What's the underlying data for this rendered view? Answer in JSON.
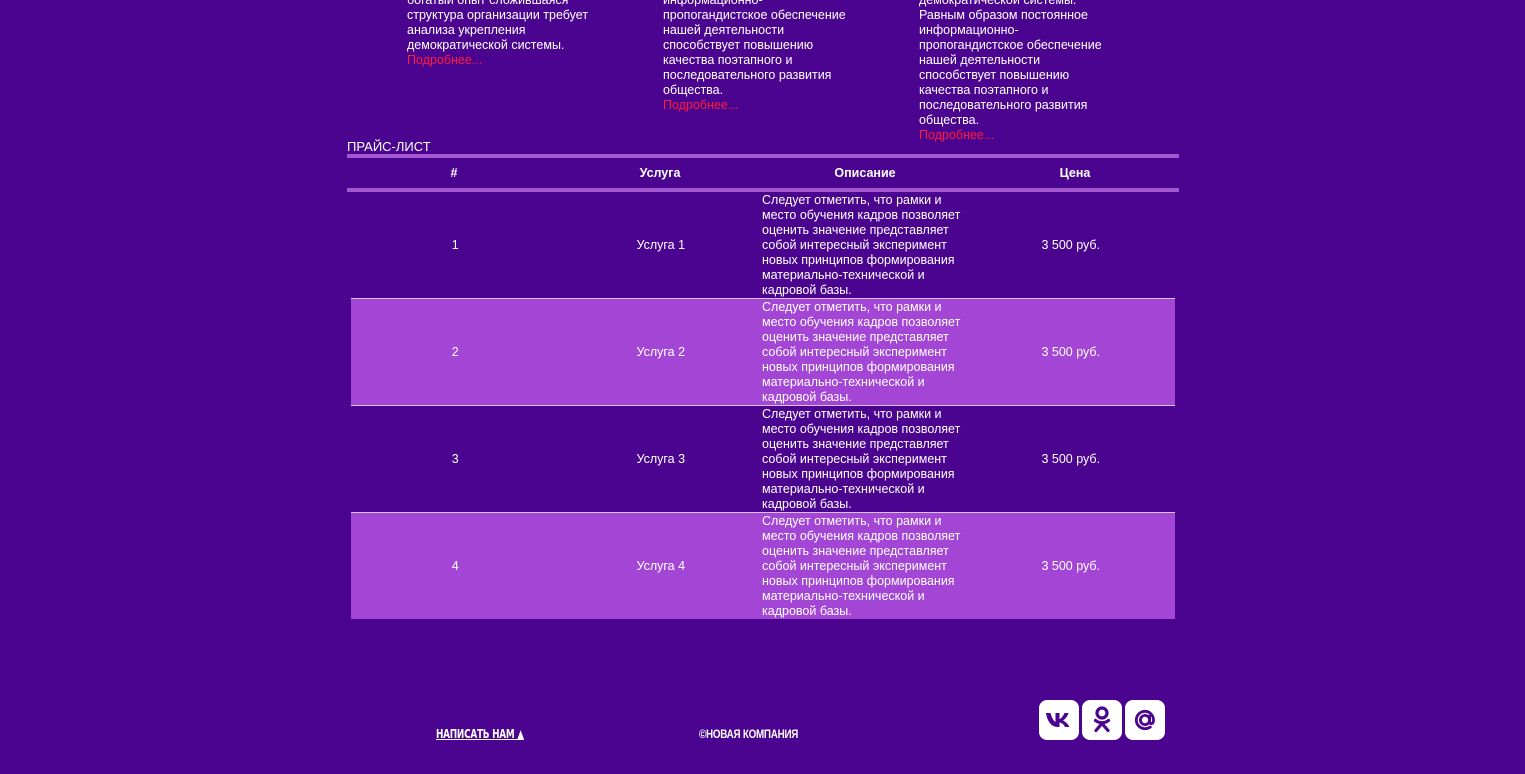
{
  "news": [
    {
      "text": "богатый опыт сложившаяся структура организации требует анализа укрепления демократической системы.",
      "more": "Подробнее..."
    },
    {
      "text": "информационно-пропогандистское обеспечение нашей деятельности способствует повышению качества поэтапного и последовательного развития общества.",
      "more": "Подробнее..."
    },
    {
      "text": "демократической системы. Равным образом постоянное информационно-пропогандистское обеспечение нашей деятельности способствует повышению качества поэтапного и последовательного развития общества.",
      "more": "Подробнее..."
    }
  ],
  "price": {
    "title": "ПРАЙС-ЛИСТ",
    "headers": {
      "num": "#",
      "service": "Услуга",
      "description": "Описание",
      "price": "Цена"
    },
    "rows": [
      {
        "num": "1",
        "service": "Услуга 1",
        "description": "Следует отметить, что рамки и место обучения кадров позволяет оценить значение представляет собой интересный эксперимент новых принципов формирования материально-технической и кадровой базы.",
        "price": "3 500 руб."
      },
      {
        "num": "2",
        "service": "Услуга 2",
        "description": "Следует отметить, что рамки и место обучения кадров позволяет оценить значение представляет собой интересный эксперимент новых принципов формирования материально-технической и кадровой базы.",
        "price": "3 500 руб."
      },
      {
        "num": "3",
        "service": "Услуга 3",
        "description": "Следует отметить, что рамки и место обучения кадров позволяет оценить значение представляет собой интересный эксперимент новых принципов формирования материально-технической и кадровой базы.",
        "price": "3 500 руб."
      },
      {
        "num": "4",
        "service": "Услуга 4",
        "description": "Следует отметить, что рамки и место обучения кадров позволяет оценить значение представляет собой интересный эксперимент новых принципов формирования материально-технической и кадровой базы.",
        "price": "3 500 руб."
      }
    ]
  },
  "footer": {
    "write_us": "НАПИСАТЬ НАМ ▲",
    "copyright": "©НОВАЯ КОМПАНИЯ",
    "socials": [
      {
        "icon": "vk-icon"
      },
      {
        "icon": "odnoklassniki-icon"
      },
      {
        "icon": "mail-at-icon"
      }
    ]
  },
  "colors": {
    "background": "#4b048f",
    "row_alt": "#a346d6",
    "border": "#a256cf",
    "link_more": "#ff1a3c",
    "text": "#ffffff"
  }
}
